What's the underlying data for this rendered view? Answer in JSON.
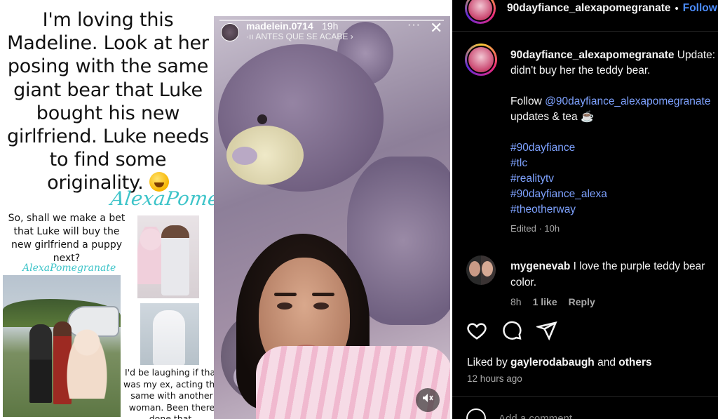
{
  "image": {
    "caption_big": "I'm loving this Madeline. Look at her posing with the same giant bear that Luke bought his new girlfriend. Luke needs to find some originality.",
    "watermark": "AlexaPomegranate",
    "caption_small": "So, shall we make a bet that Luke will buy the new girlfriend a puppy next?",
    "caption_laugh": "I'd be laughing if that was my ex, acting the same with another woman. Been there done that.",
    "story": {
      "username": "madelein.0714",
      "time": "19h",
      "music": "·ıı ANTES QUE SE ACABE ›",
      "more": "···",
      "close": "✕",
      "mute_icon": "speaker-muted-icon"
    }
  },
  "header": {
    "username": "90dayfiance_alexapomegranate",
    "dot": "•",
    "follow": "Follow"
  },
  "caption": {
    "username": "90dayfiance_alexapomegranate",
    "line1": "Update: Luke",
    "line2": "didn't buy her the teddy bear.",
    "follow_prefix": "Follow ",
    "mention": "@90dayfiance_alexapomegranate",
    "follow_suffix": "updates & tea ☕",
    "hashtags": [
      "#90dayfiance",
      "#tlc",
      "#realitytv",
      "#90dayfiance_alexa",
      "#theotherway"
    ],
    "meta": "Edited · 10h"
  },
  "comment": {
    "username": "mygenevab",
    "text": " I love the purple teddy bear",
    "line2": "color.",
    "time": "8h",
    "likes": "1 like",
    "reply": "Reply"
  },
  "actions": {
    "like_icon": "heart-icon",
    "comment_icon": "comment-icon",
    "share_icon": "send-icon"
  },
  "likes": {
    "prefix": "Liked by ",
    "user": "gaylerodabaugh",
    "middle": " and ",
    "others": "others"
  },
  "posted": "12 hours ago",
  "add_comment": {
    "placeholder": "Add a comment..."
  }
}
